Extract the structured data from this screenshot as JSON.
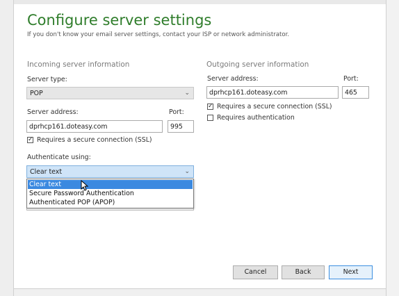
{
  "header": {
    "title": "Configure server settings",
    "subtitle": "If you don't know your email server settings, contact your ISP or network administrator."
  },
  "incoming": {
    "heading": "Incoming server information",
    "server_type_label": "Server type:",
    "server_type_value": "POP",
    "server_address_label": "Server address:",
    "server_address_value": "dprhcp161.doteasy.com",
    "port_label": "Port:",
    "port_value": "995",
    "ssl_label": "Requires a secure connection (SSL)",
    "ssl_checked": true,
    "auth_label": "Authenticate using:",
    "auth_selected": "Clear text",
    "auth_options": [
      "Clear text",
      "Secure Password Authentication",
      "Authenticated POP (APOP)"
    ]
  },
  "outgoing": {
    "heading": "Outgoing server information",
    "server_address_label": "Server address:",
    "server_address_value": "dprhcp161.doteasy.com",
    "port_label": "Port:",
    "port_value": "465",
    "ssl_label": "Requires a secure connection (SSL)",
    "ssl_checked": true,
    "auth_label": "Requires authentication",
    "auth_checked": false
  },
  "buttons": {
    "cancel": "Cancel",
    "back": "Back",
    "next": "Next"
  },
  "icons": {
    "chevron": "chevron-down-icon",
    "check": "check-icon",
    "cursor": "mouse-pointer-icon"
  },
  "colors": {
    "title": "#2f7d2b",
    "selection": "#3b89e0",
    "primary_border": "#3b8ee0"
  }
}
